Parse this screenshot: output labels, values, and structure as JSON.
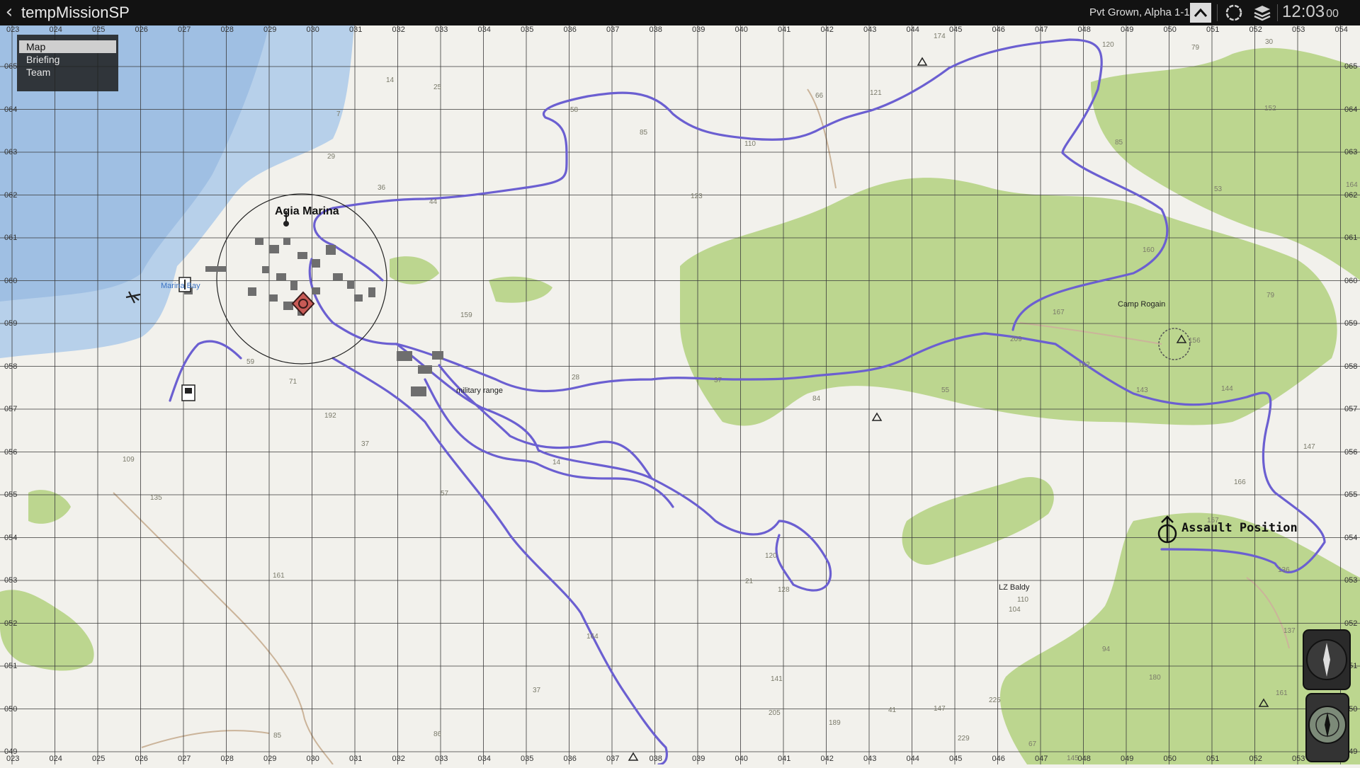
{
  "topbar": {
    "back_icon": "chevron-left-icon",
    "title": "tempMissionSP",
    "player": "Pvt Grown, Alpha 1-1 1",
    "clock_main": "12:03",
    "clock_seconds": "00"
  },
  "menu": {
    "items": [
      {
        "label": "Map",
        "selected": true
      },
      {
        "label": "Briefing",
        "selected": false
      },
      {
        "label": "Team",
        "selected": false
      }
    ]
  },
  "grid": {
    "x_labels": [
      "023",
      "024",
      "025",
      "026",
      "027",
      "028",
      "029",
      "030",
      "031",
      "032",
      "033",
      "034",
      "035",
      "036",
      "037",
      "038",
      "039",
      "040",
      "041",
      "042",
      "043",
      "044",
      "045",
      "046",
      "047",
      "048",
      "049",
      "050",
      "051",
      "052",
      "053",
      "054"
    ],
    "y_labels": [
      "065",
      "064",
      "063",
      "062",
      "061",
      "060",
      "059",
      "058",
      "057",
      "056",
      "055",
      "054",
      "053",
      "052",
      "051",
      "050",
      "049"
    ]
  },
  "labels": {
    "town": "Agia Marina",
    "bay": "Marina Bay",
    "range": "military range",
    "camp": "Camp Rogain",
    "assault": "Assault Position",
    "lz": "LZ Baldy"
  },
  "elevations": [
    "174",
    "120",
    "79",
    "30",
    "14",
    "25",
    "7",
    "29",
    "36",
    "44",
    "58",
    "85",
    "110",
    "66",
    "121",
    "123",
    "152",
    "85",
    "53",
    "164",
    "160",
    "79",
    "156",
    "167",
    "209",
    "162",
    "143",
    "144",
    "147",
    "166",
    "157",
    "136",
    "159",
    "192",
    "37",
    "57",
    "59",
    "71",
    "28",
    "37",
    "55",
    "84",
    "109",
    "135",
    "161",
    "164",
    "37",
    "86",
    "85",
    "21",
    "110",
    "137",
    "161",
    "180",
    "141",
    "205",
    "120",
    "128",
    "147",
    "104",
    "94",
    "67",
    "145",
    "229",
    "225",
    "189",
    "41",
    "14"
  ],
  "colors": {
    "route": "#6b5fd1",
    "forest": "#b9d58a",
    "water": "#a9c6e6",
    "topbar": "#121212"
  }
}
